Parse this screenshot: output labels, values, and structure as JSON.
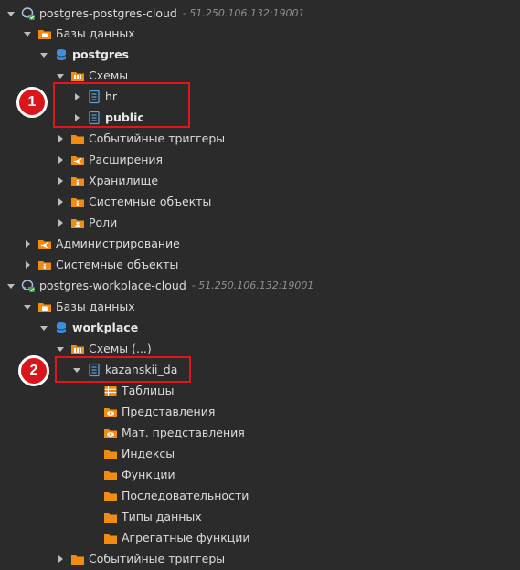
{
  "colors": {
    "background": "#2b2b2b",
    "folder": "#f08c12",
    "db": "#3b8fdc",
    "schema_icon": "#5aa0e0",
    "highlight": "#e3151a",
    "badge": "#d9161c"
  },
  "tree": {
    "conn1": {
      "name": "postgres-postgres-cloud",
      "addr": "- 51.250.106.132:19001",
      "icon": "elephant-icon"
    },
    "conn1_databases": "Базы данных",
    "conn1_db": "postgres",
    "conn1_schemas": "Схемы",
    "schema_hr": "hr",
    "schema_public": "public",
    "conn1_event_triggers": "Событийные триггеры",
    "conn1_extensions": "Расширения",
    "conn1_storage": "Хранилище",
    "conn1_system_objects": "Системные объекты",
    "conn1_roles": "Роли",
    "conn1_administration": "Администрирование",
    "conn1_system_objects_root": "Системные объекты",
    "conn2": {
      "name": "postgres-workplace-cloud",
      "addr": "- 51.250.106.132:19001",
      "icon": "elephant-icon"
    },
    "conn2_databases": "Базы данных",
    "conn2_db": "workplace",
    "conn2_schemas": "Схемы (...)",
    "schema_kazanskii": "kazanskii_da",
    "tables": "Таблицы",
    "views": "Представления",
    "mat_views": "Мат. представления",
    "indexes": "Индексы",
    "functions": "Функции",
    "sequences": "Последовательности",
    "data_types": "Типы данных",
    "aggregate_functions": "Агрегатные функции",
    "conn2_event_triggers": "Событийные триггеры"
  },
  "annotations": {
    "badge1": "1",
    "badge2": "2"
  }
}
